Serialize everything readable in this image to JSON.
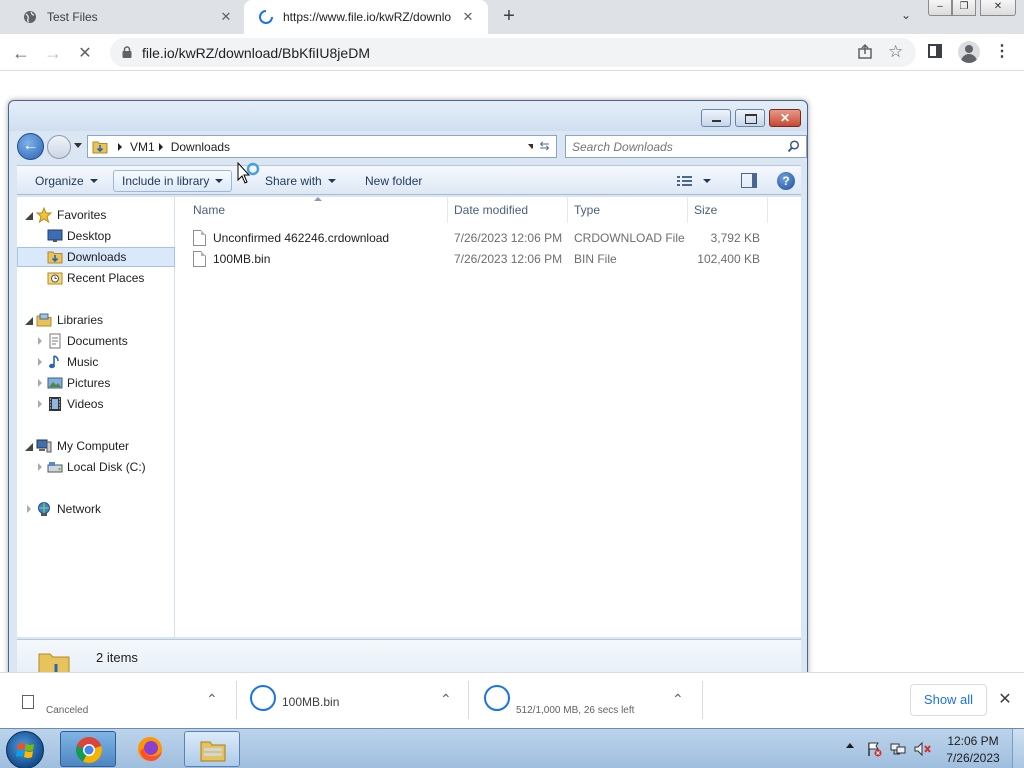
{
  "browser": {
    "tabs": [
      {
        "title": "Test Files",
        "icon": "globe-icon"
      },
      {
        "title": "https://www.file.io/kwRZ/downlo",
        "icon": "loading-spinner-icon"
      }
    ],
    "url": "file.io/kwRZ/download/BbKfiIU8jeDM",
    "new_tab": "+"
  },
  "explorer": {
    "breadcrumb": [
      "VM1",
      "Downloads"
    ],
    "search_placeholder": "Search Downloads",
    "commands": {
      "organize": "Organize",
      "include": "Include in library",
      "share": "Share with",
      "new_folder": "New folder"
    },
    "nav": {
      "favorites": "Favorites",
      "desktop": "Desktop",
      "downloads": "Downloads",
      "recent": "Recent Places",
      "libraries": "Libraries",
      "documents": "Documents",
      "music": "Music",
      "pictures": "Pictures",
      "videos": "Videos",
      "computer": "My Computer",
      "local_disk": "Local Disk (C:)",
      "network": "Network"
    },
    "columns": {
      "name": "Name",
      "date": "Date modified",
      "type": "Type",
      "size": "Size"
    },
    "files": [
      {
        "name": "Unconfirmed 462246.crdownload",
        "date": "7/26/2023 12:06 PM",
        "type": "CRDOWNLOAD File",
        "size": "3,792 KB"
      },
      {
        "name": "100MB.bin",
        "date": "7/26/2023 12:06 PM",
        "type": "BIN File",
        "size": "102,400 KB"
      }
    ],
    "item_count": "2 items"
  },
  "downloads_shelf": {
    "items": [
      {
        "name": "",
        "status": "Canceled"
      },
      {
        "name": "100MB.bin",
        "status": ""
      },
      {
        "name": "",
        "status": "512/1,000 MB, 26 secs left"
      }
    ],
    "show_all": "Show all"
  },
  "taskbar": {
    "apps": [
      "chrome-icon",
      "firefox-icon",
      "windows-explorer-icon"
    ],
    "time": "12:06 PM",
    "date": "7/26/2023"
  },
  "colors": {
    "chrome_tabstrip": "#dee1e6",
    "explorer_frame": "#dbe6f3",
    "taskbar": "#9fbedd",
    "link_blue": "#1a73e8"
  }
}
